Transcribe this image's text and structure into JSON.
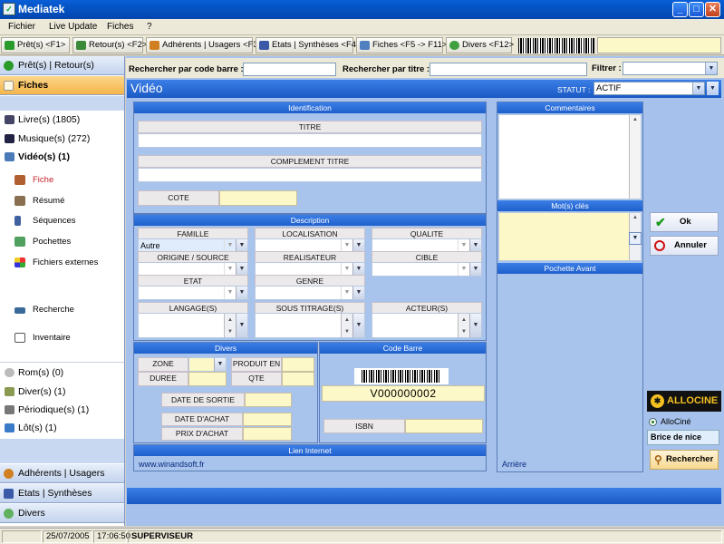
{
  "window": {
    "title": "Mediatek"
  },
  "menu": [
    "Fichier",
    "Live Update",
    "Fiches",
    "?"
  ],
  "toolbar": {
    "items": [
      "Prêt(s) <F1>",
      "Retour(s) <F2>",
      "Adhérents | Usagers <F3>",
      "Etats | Synthèses <F4>",
      "Fiches <F5 -> F11>",
      "Divers <F12>"
    ],
    "colors": [
      "#2a9a2a",
      "#3a8a3a",
      "#d08020",
      "#3a5aa8",
      "#5080c0",
      "#40a040"
    ]
  },
  "sidebar": {
    "top": [
      "Prêt(s) | Retour(s)",
      "Fiches"
    ],
    "categories": [
      "Livre(s) (1805)",
      "Musique(s) (272)",
      "Vidéo(s) (1)"
    ],
    "sub": [
      "Fiche",
      "Résumé",
      "Séquences",
      "Pochettes",
      "Fichiers externes",
      "Recherche",
      "Inventaire"
    ],
    "others": [
      "Rom(s) (0)",
      "Diver(s) (1)",
      "Périodique(s) (1)",
      "Lôt(s) (1)"
    ],
    "bottom": [
      "Adhérents | Usagers",
      "Etats | Synthèses",
      "Divers"
    ]
  },
  "search": {
    "barcode_label": "Rechercher par code barre :",
    "title_label": "Rechercher par titre :",
    "filter_label": "Filtrer :"
  },
  "header": {
    "title": "Vidéo",
    "statut_label": "STATUT :",
    "statut_value": "ACTIF"
  },
  "identification": {
    "heading": "Identification",
    "titre": "TITRE",
    "complement": "COMPLEMENT TITRE",
    "cote": "COTE"
  },
  "description": {
    "heading": "Description",
    "famille": "FAMILLE",
    "famille_value": "Autre",
    "localisation": "LOCALISATION",
    "qualite": "QUALITE",
    "origine": "ORIGINE / SOURCE",
    "realisateur": "REALISATEUR",
    "cible": "CIBLE",
    "etat": "ETAT",
    "genre": "GENRE",
    "langage": "LANGAGE(S)",
    "sous_titrage": "SOUS TITRAGE(S)",
    "acteur": "ACTEUR(S)"
  },
  "divers": {
    "heading": "Divers",
    "zone": "ZONE",
    "duree": "DUREE",
    "produit_en": "PRODUIT EN",
    "qte": "QTE",
    "date_sortie": "DATE DE SORTIE",
    "date_achat": "DATE D'ACHAT",
    "prix_achat": "PRIX D'ACHAT"
  },
  "code_barre": {
    "heading": "Code Barre",
    "value": "V000000002",
    "isbn": "ISBN"
  },
  "lien": {
    "heading": "Lien Internet",
    "url": "www.winandsoft.fr"
  },
  "right": {
    "commentaires": "Commentaires",
    "mots_cles": "Mot(s) clés",
    "pochette_avant": "Pochette Avant",
    "arriere": "Arrière"
  },
  "actions": {
    "ok": "Ok",
    "annuler": "Annuler",
    "allocine_logo": "ALLOCINE",
    "allocine_radio": "AlloCiné",
    "search_value": "Brice de nice",
    "rechercher": "Rechercher"
  },
  "status": {
    "date": "25/07/2005",
    "time": "17:06:50",
    "user": "SUPERVISEUR"
  }
}
